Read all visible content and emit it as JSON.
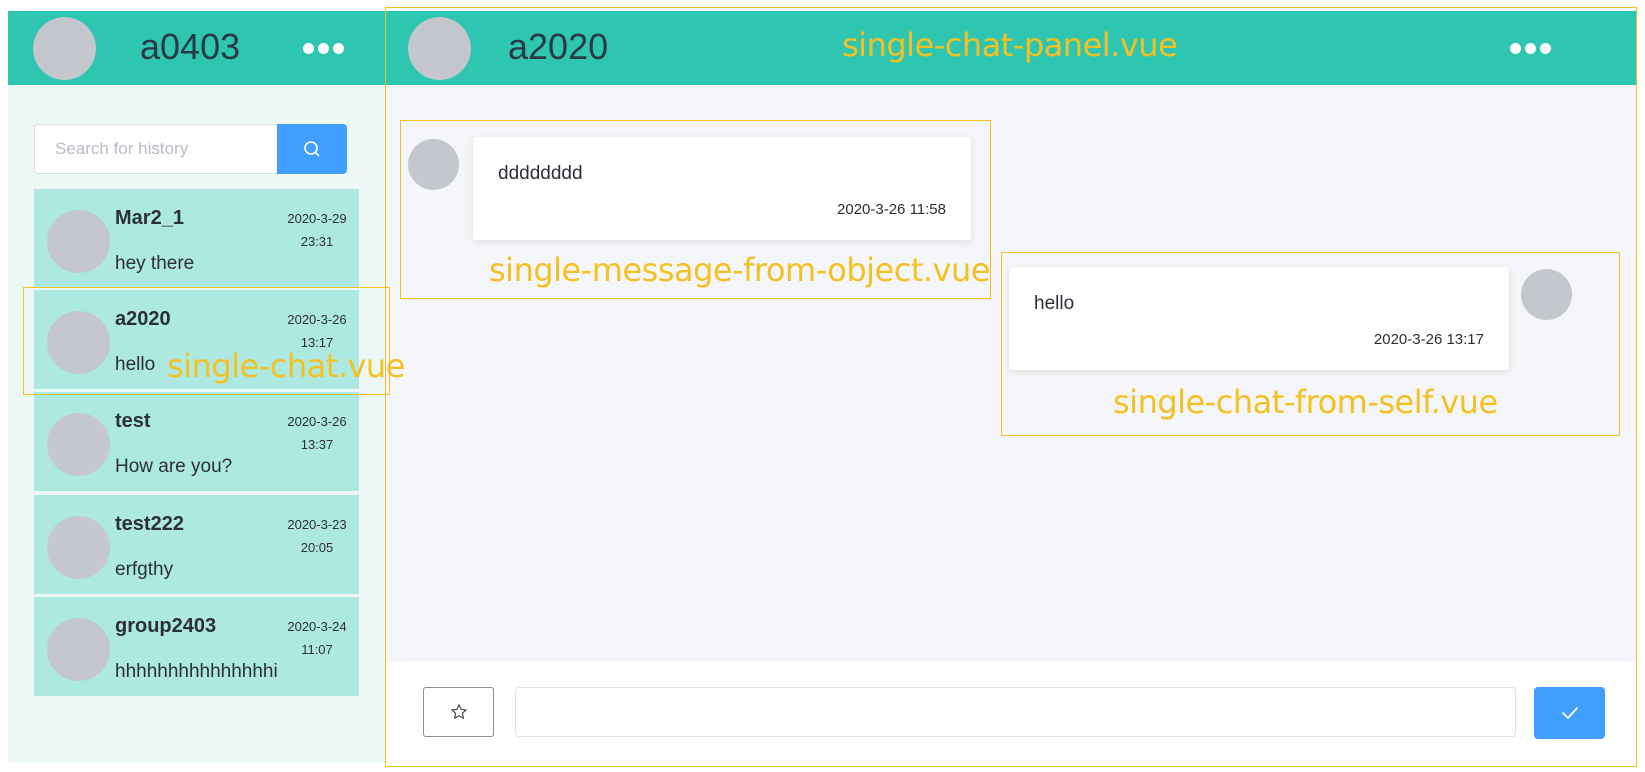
{
  "left_header": {
    "user_name": "a0403",
    "more_icon": "more-horizontal-icon"
  },
  "search": {
    "placeholder": "Search for history",
    "icon": "search-icon"
  },
  "chats": [
    {
      "name": "Mar2_1",
      "date": "2020-3-29",
      "time": "23:31",
      "preview": "hey there"
    },
    {
      "name": "a2020",
      "date": "2020-3-26",
      "time": "13:17",
      "preview": "hello"
    },
    {
      "name": "test",
      "date": "2020-3-26",
      "time": "13:37",
      "preview": "How are you?"
    },
    {
      "name": "test222",
      "date": "2020-3-23",
      "time": "20:05",
      "preview": "erfgthy"
    },
    {
      "name": "group2403",
      "date": "2020-3-24",
      "time": "11:07",
      "preview": "hhhhhhhhhhhhhhhi"
    }
  ],
  "right_header": {
    "contact_name": "a2020",
    "more_icon": "more-horizontal-icon"
  },
  "messages": [
    {
      "from": "object",
      "text": "dddddddd",
      "timestamp": "2020-3-26 11:58"
    },
    {
      "from": "self",
      "text": "hello",
      "timestamp": "2020-3-26 13:17"
    }
  ],
  "input_bar": {
    "star_icon": "star-icon",
    "send_icon": "check-icon",
    "message_value": ""
  },
  "annotations": {
    "panel": "single-chat-panel.vue",
    "chat": "single-chat.vue",
    "from_object": "single-message-from-object.vue",
    "from_self": "single-chat-from-self.vue"
  },
  "colors": {
    "header": "#2ec6b0",
    "sidebar": "#ecf7f6",
    "chat_item": "#ade9e0",
    "accent": "#409eff",
    "annotation": "#f5c022",
    "avatar": "#c4c7cd"
  }
}
